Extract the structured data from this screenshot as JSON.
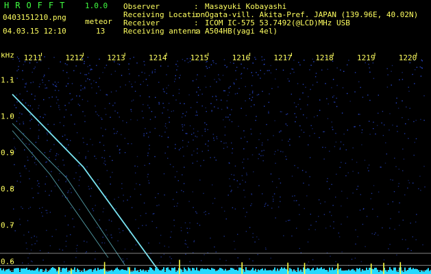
{
  "header": {
    "app_title": "HROFFT",
    "version": "1.0.0",
    "filename": "0403151210.png",
    "timestamp": "04.03.15 12:10",
    "meteor_label": "meteor",
    "meteor_count": "13"
  },
  "info": [
    {
      "key": "Observer",
      "value": "Masayuki Kobayashi"
    },
    {
      "key": "Receiving Location",
      "value": "Ogata-vill. Akita-Pref. JAPAN (139.96E, 40.02N)"
    },
    {
      "key": "Receiver",
      "value": "ICOM IC-575 53.7492(@LCD)MHz USB"
    },
    {
      "key": "Receiving antenna",
      "value": "A504HB(yagi 4el)"
    }
  ],
  "separator": ":",
  "colors": {
    "background": "#000000",
    "text": "#ffff60",
    "title": "#40ff40",
    "noise": "#1e2fa0",
    "echo": "#7ff0ff",
    "baseline": "#26d9ff",
    "spike": "#ffff40"
  },
  "chart_data": {
    "type": "heatmap",
    "ylabel": "kHz",
    "x_ticks": [
      "1211",
      "1212",
      "1213",
      "1214",
      "1215",
      "1216",
      "1217",
      "1218",
      "1219",
      "1220"
    ],
    "y_ticks": [
      "1.1",
      "1.0",
      "0.9",
      "0.8",
      "0.7",
      "0.6"
    ],
    "xlim": [
      1210.3,
      1220.2
    ],
    "ylim": [
      0.565,
      1.165
    ],
    "echoes": [
      {
        "x": [
          1210.3,
          1212.0,
          1213.9
        ],
        "y": [
          1.06,
          0.86,
          0.56
        ]
      },
      {
        "x": [
          1210.3,
          1211.6,
          1213.0
        ],
        "y": [
          0.98,
          0.83,
          0.59
        ]
      },
      {
        "x": [
          1210.3,
          1211.2,
          1212.6
        ],
        "y": [
          0.96,
          0.84,
          0.61
        ]
      }
    ],
    "reference_lines_khz": [
      0.622,
      0.589,
      0.574
    ],
    "spike_minutes": [
      1211.4,
      1211.7,
      1212.5,
      1213.1,
      1214.3,
      1215.8,
      1216.9,
      1217.3,
      1218.1,
      1218.9,
      1219.2,
      1219.6
    ]
  }
}
